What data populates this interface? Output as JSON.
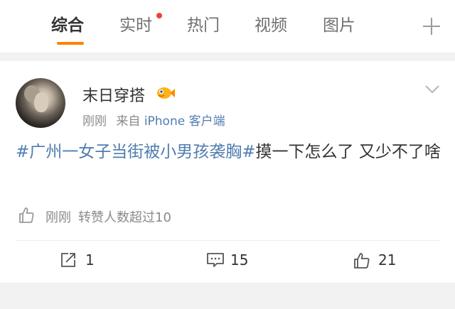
{
  "tabs": [
    {
      "label": "综合",
      "active": true
    },
    {
      "label": "实时",
      "active": false,
      "has_dot": true
    },
    {
      "label": "热门",
      "active": false
    },
    {
      "label": "视频",
      "active": false
    },
    {
      "label": "图片",
      "active": false
    }
  ],
  "accent_color": "#ff8200",
  "link_color": "#507daf",
  "post": {
    "username": "末日穿搭",
    "time": "刚刚",
    "source_prefix": "来自",
    "source": "iPhone 客户端",
    "topic": "#广州一女子当街被小男孩袭胸#",
    "text": "摸一下怎么了 又少不了啥",
    "likes_time": "刚刚",
    "likes_text": "转赞人数超过10",
    "reposts": "1",
    "comments": "15",
    "likes": "21"
  }
}
